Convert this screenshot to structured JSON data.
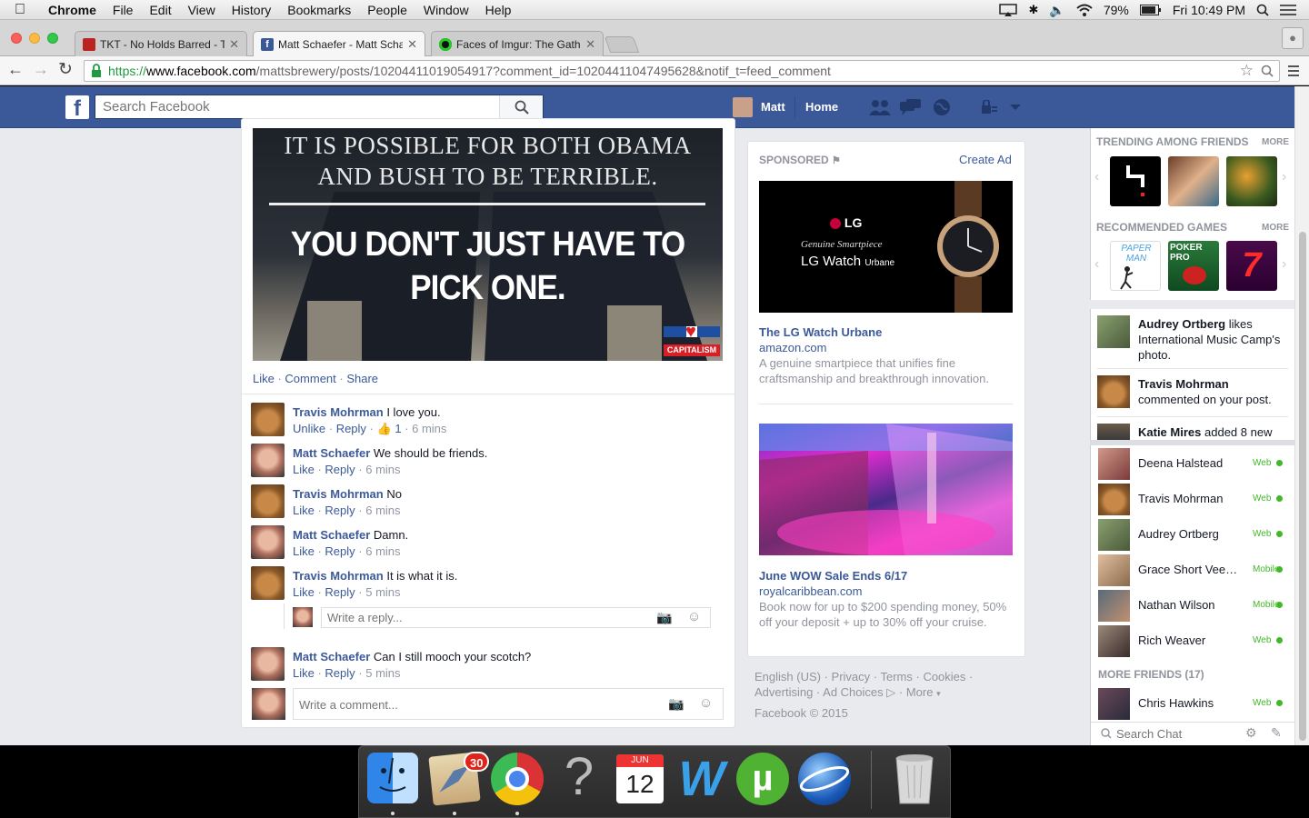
{
  "menubar": {
    "app": "Chrome",
    "items": [
      "File",
      "Edit",
      "View",
      "History",
      "Bookmarks",
      "People",
      "Window",
      "Help"
    ],
    "battery": "79%",
    "clock": "Fri 10:49 PM"
  },
  "tabs": [
    {
      "title": "TKT - No Holds Barred - T",
      "color": "#b22"
    },
    {
      "title": "Matt Schaefer - Matt Scha",
      "color": "#3b5998"
    },
    {
      "title": "Faces of Imgur: The Gathe",
      "color": "#2c2"
    }
  ],
  "url": {
    "scheme": "https://",
    "host": "www.facebook.com",
    "path": "/mattsbrewery/posts/10204411019054917?comment_id=10204411047495628&notif_t=feed_comment"
  },
  "fb": {
    "search_placeholder": "Search Facebook",
    "user": "Matt",
    "home": "Home",
    "post_image": {
      "line1": "IT IS POSSIBLE FOR BOTH OBAMA",
      "line2": "AND BUSH TO BE TERRIBLE.",
      "line3": "YOU DON'T JUST HAVE TO PICK ONE.",
      "badge": "CAPITALISM"
    },
    "actions": {
      "like": "Like",
      "comment": "Comment",
      "share": "Share"
    },
    "comments": [
      {
        "name": "Travis Mohrman",
        "text": "I love you.",
        "act": "Unlike",
        "reply": "Reply",
        "likes": "1",
        "time": "6 mins",
        "who": "cat"
      },
      {
        "name": "Matt Schaefer",
        "text": "We should be friends.",
        "act": "Like",
        "reply": "Reply",
        "time": "6 mins",
        "who": "man"
      },
      {
        "name": "Travis Mohrman",
        "text": "No",
        "act": "Like",
        "reply": "Reply",
        "time": "6 mins",
        "who": "cat"
      },
      {
        "name": "Matt Schaefer",
        "text": "Damn.",
        "act": "Like",
        "reply": "Reply",
        "time": "6 mins",
        "who": "man"
      },
      {
        "name": "Travis Mohrman",
        "text": "It is what it is.",
        "act": "Like",
        "reply": "Reply",
        "time": "5 mins",
        "who": "cat"
      }
    ],
    "reply_placeholder": "Write a reply...",
    "last_comment": {
      "name": "Matt Schaefer",
      "text": "Can I still mooch your scotch?",
      "act": "Like",
      "reply": "Reply",
      "time": "5 mins"
    },
    "comment_placeholder": "Write a comment...",
    "sponsored": {
      "label": "SPONSORED",
      "create": "Create Ad"
    },
    "ads": [
      {
        "title": "The LG Watch Urbane",
        "domain": "amazon.com",
        "body1": "A genuine smartpiece that unifies fine",
        "body2": "craftsmanship and breakthrough innovation.",
        "img_brand": "LG",
        "img_l1": "Genuine Smartpiece",
        "img_l2": "LG Watch",
        "img_l3": "Urbane"
      },
      {
        "title": "June WOW Sale Ends 6/17",
        "domain": "royalcaribbean.com",
        "body1": "Book now for up to $200 spending money, 50%",
        "body2": "off your deposit + up to 30% off your cruise."
      }
    ],
    "footer": {
      "l1": [
        "English (US)",
        "Privacy",
        "Terms",
        "Cookies"
      ],
      "l2": [
        "Advertising",
        "Ad Choices",
        "More"
      ],
      "copyright": "Facebook © 2015"
    },
    "trending": {
      "title": "TRENDING AMONG FRIENDS",
      "more": "MORE"
    },
    "recommended": {
      "title": "RECOMMENDED GAMES",
      "more": "MORE",
      "game1": "PAPER MAN",
      "game2": "POKER PRO"
    },
    "ticker": [
      {
        "name": "Audrey Ortberg",
        "rest": "likes International Music Camp's photo."
      },
      {
        "name": "Travis Mohrman",
        "rest": "commented on your post."
      },
      {
        "name": "Katie Mires",
        "rest": "added 8 new"
      }
    ],
    "chat": [
      {
        "name": "Deena Halstead",
        "status": "Web"
      },
      {
        "name": "Travis Mohrman",
        "status": "Web"
      },
      {
        "name": "Audrey Ortberg",
        "status": "Web"
      },
      {
        "name": "Grace Short Vee…",
        "status": "Mobile"
      },
      {
        "name": "Nathan Wilson",
        "status": "Mobile"
      },
      {
        "name": "Rich Weaver",
        "status": "Web"
      }
    ],
    "more_friends": "MORE FRIENDS (17)",
    "more_friend": {
      "name": "Chris Hawkins",
      "status": "Web"
    },
    "search_chat": "Search Chat"
  },
  "dock": {
    "mail_badge": "30",
    "cal_month": "JUN",
    "cal_day": "12"
  }
}
